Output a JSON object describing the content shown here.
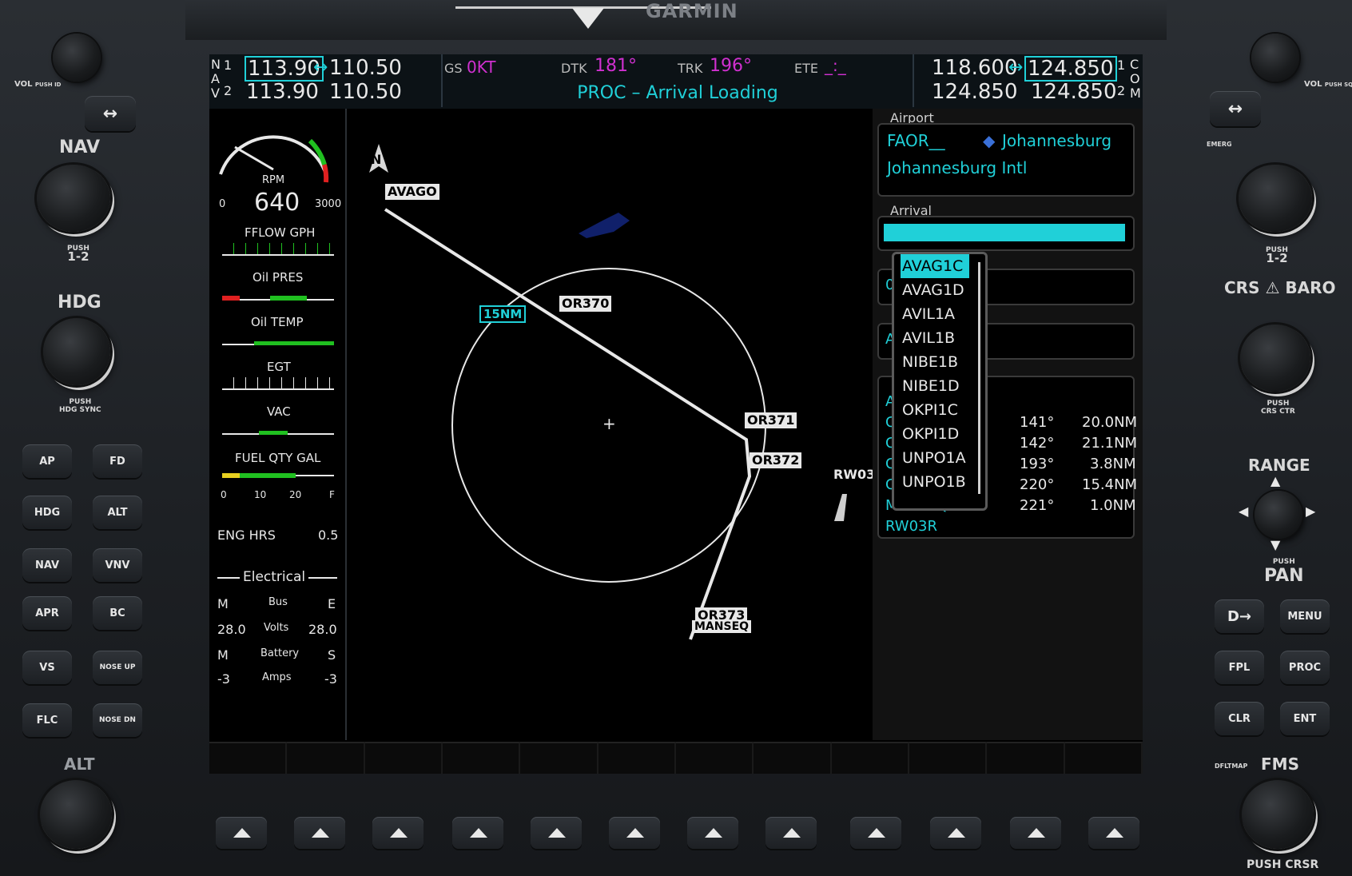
{
  "brand": "GARMIN",
  "nav": {
    "label_n": "N",
    "label_a": "A",
    "label_v": "V",
    "n1": "1",
    "n2": "2",
    "nav1_active": "113.90",
    "nav1_standby": "110.50",
    "nav2_active": "113.90",
    "nav2_standby": "110.50"
  },
  "com": {
    "label_c": "C",
    "label_o": "O",
    "label_m": "M",
    "c1": "1",
    "c2": "2",
    "com1_active": "118.600",
    "com1_standby": "124.850",
    "com2_active": "124.850",
    "com2_standby": "124.850"
  },
  "nav_data": {
    "gs_label": "GS",
    "gs_value": "0KT",
    "dtk_label": "DTK",
    "dtk_value": "181°",
    "trk_label": "TRK",
    "trk_value": "196°",
    "ete_label": "ETE",
    "ete_value": "_:_",
    "message": "PROC – Arrival Loading"
  },
  "eis": {
    "rpm_label": "RPM",
    "rpm_value": "640",
    "rpm_min": "0",
    "rpm_max": "3000",
    "fflow_label": "FFLOW GPH",
    "oil_pres_label": "Oil PRES",
    "oil_temp_label": "Oil TEMP",
    "egt_label": "EGT",
    "vac_label": "VAC",
    "fuel_label": "FUEL QTY GAL",
    "fuel_ticks": [
      "0",
      "10",
      "20",
      "F"
    ],
    "eng_hrs_label": "ENG HRS",
    "eng_hrs_value": "0.5",
    "electrical_label": "Electrical",
    "bus_m": "M",
    "bus_label": "Bus",
    "bus_e": "E",
    "volts_left": "28.0",
    "volts_label": "Volts",
    "volts_right": "28.0",
    "batt_m": "M",
    "battery_label": "Battery",
    "batt_s": "S",
    "amps_left": "-3",
    "amps_label": "Amps",
    "amps_right": "-3"
  },
  "map": {
    "north_label": "N",
    "range_label": "15NM",
    "waypoints": [
      "AVAGO",
      "OR370",
      "OR371",
      "OR372",
      "OR373",
      "MANSEQ",
      "RW03"
    ],
    "center_mark": "+"
  },
  "proc": {
    "airport_label": "Airport",
    "airport_ident": "FAOR__",
    "airport_city": "Johannesburg",
    "airport_name": "Johannesburg Intl",
    "arrival_label": "Arrival",
    "field_a": "0",
    "field_b": "A",
    "leg_prefixes": [
      "A",
      "C",
      "C",
      "C",
      "C"
    ],
    "legs": [
      {
        "crs": "141°",
        "dist": "20.0NM"
      },
      {
        "crs": "142°",
        "dist": "21.1NM"
      },
      {
        "crs": "193°",
        "dist": "3.8NM"
      },
      {
        "crs": "220°",
        "dist": "15.4NM"
      },
      {
        "crs": "221°",
        "dist": "1.0NM"
      }
    ],
    "last_wps": [
      "MANSEQ",
      "RW03R"
    ],
    "dropdown": [
      "AVAG1C",
      "AVAG1D",
      "AVIL1A",
      "AVIL1B",
      "NIBE1B",
      "NIBE1D",
      "OKPI1C",
      "OKPI1D",
      "UNPO1A",
      "UNPO1B"
    ]
  },
  "left_panel": {
    "vol_label": "VOL",
    "vol_push": "PUSH ID",
    "nav_label": "NAV",
    "push_12": "PUSH",
    "push_12b": "1-2",
    "hdg_label": "HDG",
    "hdg_push": "PUSH",
    "hdg_sync": "HDG SYNC",
    "alt_label": "ALT",
    "buttons": [
      "AP",
      "FD",
      "HDG",
      "ALT",
      "NAV",
      "VNV",
      "APR",
      "BC",
      "VS",
      "NOSE UP",
      "FLC",
      "NOSE DN"
    ]
  },
  "right_panel": {
    "vol_label": "VOL",
    "vol_push": "PUSH SQ",
    "emerg_label": "EMERG",
    "push_label": "PUSH",
    "push_12": "1-2",
    "crs_label": "CRS",
    "baro_label": "BARO",
    "crs_push": "PUSH",
    "crs_ctr": "CRS CTR",
    "range_label": "RANGE",
    "pan_push": "PUSH",
    "pan_label": "PAN",
    "buttons": [
      "D→",
      "MENU",
      "FPL",
      "PROC",
      "CLR",
      "ENT"
    ],
    "dfltmap_label": "DFLTMAP",
    "fms_label": "FMS",
    "push_crsr": "PUSH CRSR"
  },
  "colors": {
    "cyan": "#20d0d8",
    "magenta": "#d030d0",
    "screen": "#000000"
  }
}
